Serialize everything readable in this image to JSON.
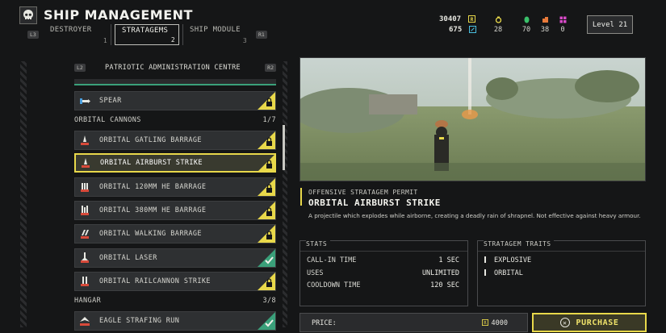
{
  "header": {
    "title": "SHIP MANAGEMENT",
    "kbd_left": "L3",
    "kbd_right": "R1",
    "tabs": [
      {
        "label": "DESTROYER",
        "num": "1"
      },
      {
        "label": "STRATAGEMS",
        "num": "2"
      },
      {
        "label": "SHIP MODULE",
        "num": "3"
      }
    ],
    "req_slips": "30407",
    "medals": "675",
    "samples": [
      "28",
      "70",
      "38",
      "0"
    ],
    "level": "Level 21"
  },
  "list": {
    "kbd_l": "L2",
    "kbd_r": "R2",
    "title": "PATRIOTIC ADMINISTRATION CENTRE",
    "spear": "SPEAR",
    "sections": [
      {
        "name": "ORBITAL CANNONS",
        "count": "1/7"
      },
      {
        "name": "HANGAR",
        "count": "3/8"
      }
    ],
    "items": [
      "ORBITAL GATLING BARRAGE",
      "ORBITAL AIRBURST STRIKE",
      "ORBITAL 120MM HE BARRAGE",
      "ORBITAL 380MM HE BARRAGE",
      "ORBITAL WALKING BARRAGE",
      "ORBITAL LASER",
      "ORBITAL RAILCANNON STRIKE"
    ],
    "eagle": "EAGLE STRAFING RUN"
  },
  "details": {
    "permit": "OFFENSIVE STRATAGEM PERMIT",
    "name": "ORBITAL AIRBURST STRIKE",
    "description": "A projectile which explodes while airborne, creating a deadly rain of shrapnel. Not effective against heavy armour.",
    "stats_title": "STATS",
    "stats": [
      {
        "label": "CALL-IN TIME",
        "value": "1 SEC"
      },
      {
        "label": "USES",
        "value": "UNLIMITED"
      },
      {
        "label": "COOLDOWN TIME",
        "value": "120 SEC"
      }
    ],
    "traits_title": "STRATAGEM TRAITS",
    "traits": [
      "EXPLOSIVE",
      "ORBITAL"
    ],
    "price_label": "PRICE:",
    "price_value": "4000",
    "purchase_label": "PURCHASE"
  },
  "colors": {
    "accent_yellow": "#e8d84a",
    "owned_green": "#3aa07a",
    "panel": "#2e3032"
  }
}
